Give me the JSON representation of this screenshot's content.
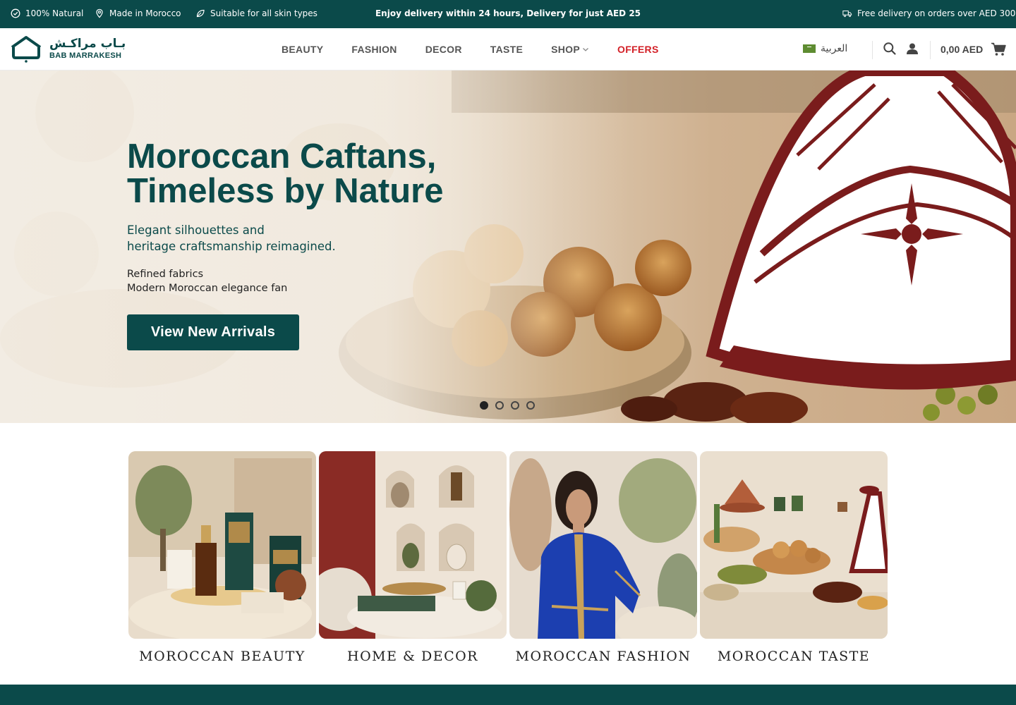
{
  "topbar": {
    "natural": "100% Natural",
    "origin": "Made in Morocco",
    "skin": "Suitable for all skin types",
    "center": "Enjoy delivery within 24 hours, Delivery for just AED 25",
    "free_delivery": "Free delivery on orders over AED 300"
  },
  "header": {
    "logo_ar": "بـاب مراكـش",
    "logo_en": "BAB MARRAKESH",
    "nav": {
      "beauty": "BEAUTY",
      "fashion": "FASHION",
      "decor": "DECOR",
      "taste": "TASTE",
      "shop": "SHOP",
      "offers": "OFFERS"
    },
    "language": "العربية",
    "cart_total": "0,00 AED",
    "icons": [
      "search-icon",
      "user-icon",
      "cart-icon"
    ]
  },
  "hero": {
    "title_line1": "Moroccan Caftans,",
    "title_line2": "Timeless by Nature",
    "subtitle_line1": "Elegant silhouettes and",
    "subtitle_line2": "heritage craftsmanship reimagined.",
    "desc_line1": "Refined fabrics",
    "desc_line2": "Modern Moroccan elegance fan",
    "cta": "View New Arrivals",
    "slides_total": 4,
    "active_slide": 1
  },
  "categories": [
    {
      "label": "MOROCCAN BEAUTY"
    },
    {
      "label": "HOME & DECOR"
    },
    {
      "label": "MOROCCAN FASHION"
    },
    {
      "label": "MOROCCAN TASTE"
    }
  ],
  "colors": {
    "brand": "#0b4a4a",
    "offers": "#d32027"
  }
}
